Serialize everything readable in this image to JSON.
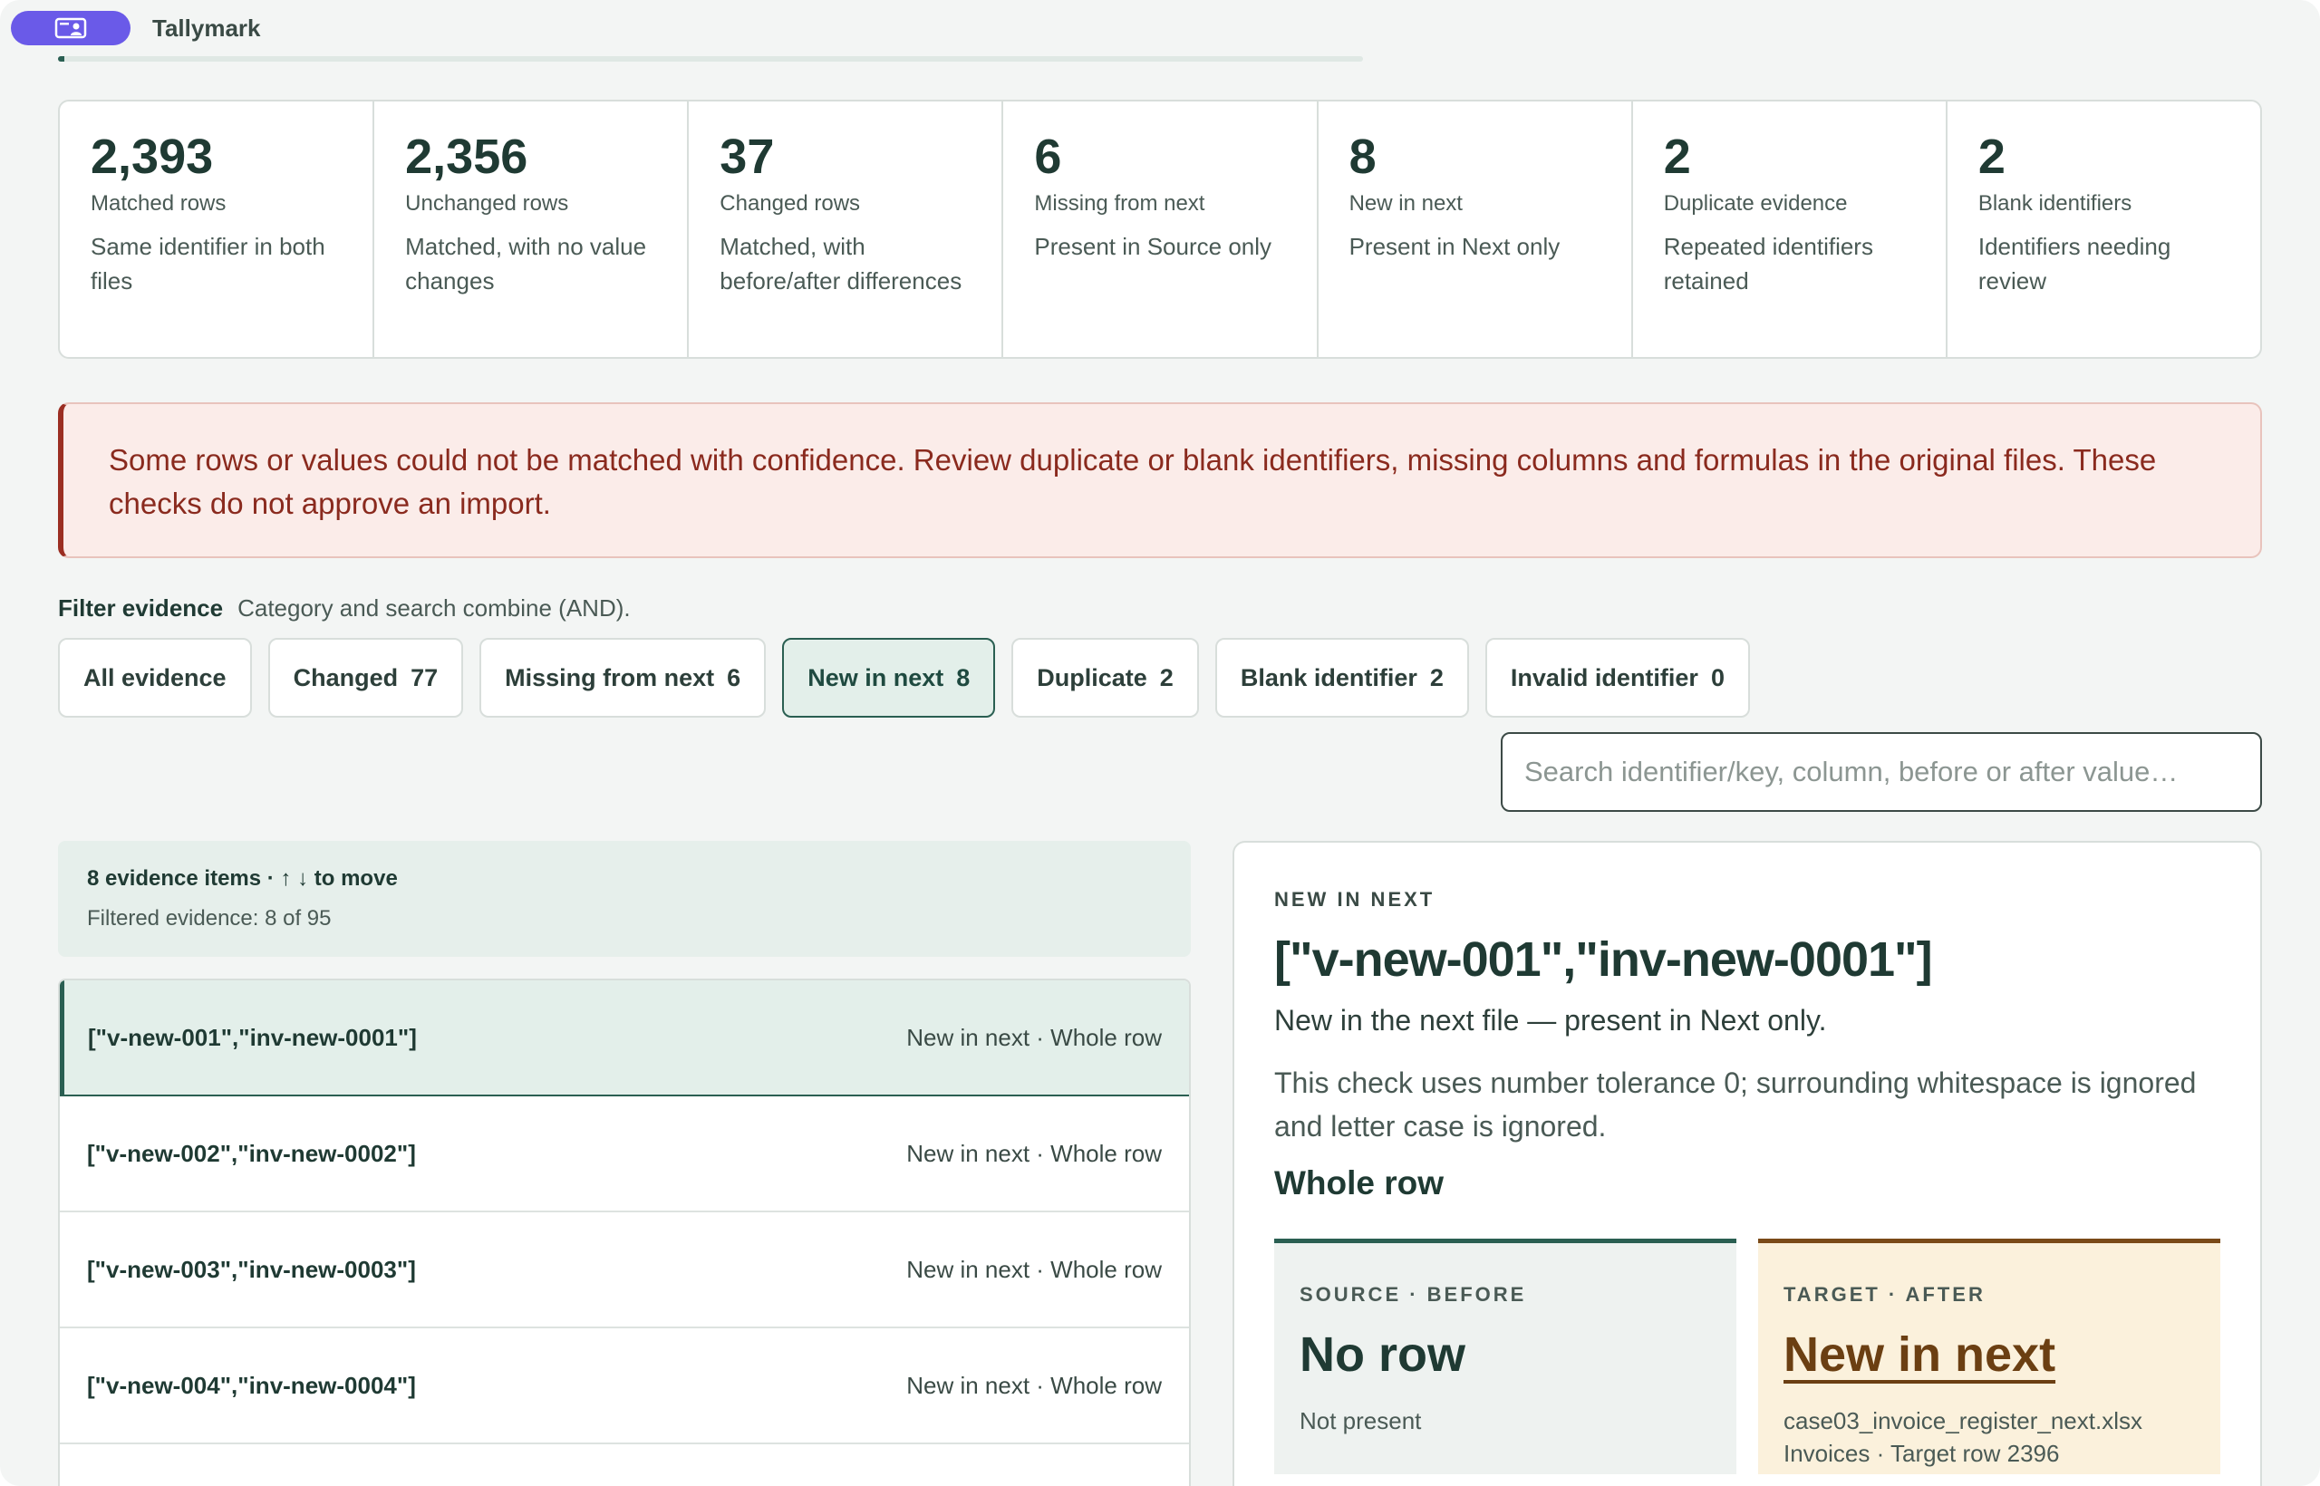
{
  "app": {
    "title": "Tallymark",
    "progress_fraction": 0.005
  },
  "stats": [
    {
      "value": "2,393",
      "label": "Matched rows",
      "desc": "Same identifier in both files"
    },
    {
      "value": "2,356",
      "label": "Unchanged rows",
      "desc": "Matched, with no value changes"
    },
    {
      "value": "37",
      "label": "Changed rows",
      "desc": "Matched, with before/after differences"
    },
    {
      "value": "6",
      "label": "Missing from next",
      "desc": "Present in Source only"
    },
    {
      "value": "8",
      "label": "New in next",
      "desc": "Present in Next only"
    },
    {
      "value": "2",
      "label": "Duplicate evidence",
      "desc": "Repeated identifiers retained"
    },
    {
      "value": "2",
      "label": "Blank identifiers",
      "desc": "Identifiers needing review"
    }
  ],
  "alert": {
    "text": "Some rows or values could not be matched with confidence. Review duplicate or blank identifiers, missing columns and formulas in the original files. These checks do not approve an import."
  },
  "filter": {
    "title": "Filter evidence",
    "subtitle": "Category and search combine (AND).",
    "chips": [
      {
        "label": "All evidence",
        "count": ""
      },
      {
        "label": "Changed",
        "count": "77"
      },
      {
        "label": "Missing from next",
        "count": "6"
      },
      {
        "label": "New in next",
        "count": "8"
      },
      {
        "label": "Duplicate",
        "count": "2"
      },
      {
        "label": "Blank identifier",
        "count": "2"
      },
      {
        "label": "Invalid identifier",
        "count": "0"
      }
    ],
    "active_chip": "New in next",
    "search_placeholder": "Search identifier/key, column, before or after value…"
  },
  "list": {
    "header": "8 evidence items · ↑ ↓ to move",
    "filtered": "Filtered evidence: 8 of 95",
    "rows": [
      {
        "key": "[\"v-new-001\",\"inv-new-0001\"]",
        "meta": "New in next · Whole row"
      },
      {
        "key": "[\"v-new-002\",\"inv-new-0002\"]",
        "meta": "New in next · Whole row"
      },
      {
        "key": "[\"v-new-003\",\"inv-new-0003\"]",
        "meta": "New in next · Whole row"
      },
      {
        "key": "[\"v-new-004\",\"inv-new-0004\"]",
        "meta": "New in next · Whole row"
      },
      {
        "key": "",
        "meta": ""
      }
    ]
  },
  "detail": {
    "category": "NEW IN NEXT",
    "title": "[\"v-new-001\",\"inv-new-0001\"]",
    "summary": "New in the next file — present in Next only.",
    "note": "This check uses number tolerance 0; surrounding whitespace is ignored and letter case is ignored.",
    "section": "Whole row",
    "source": {
      "label": "SOURCE · BEFORE",
      "value": "No row",
      "sub": "Not present"
    },
    "target": {
      "label": "TARGET · AFTER",
      "value": "New in next",
      "file": "case03_invoice_register_next.xlsx",
      "location": "Invoices · Target row 2396"
    }
  },
  "colors": {
    "accent": "#2a5f52",
    "app_pill": "#6a5ae8",
    "alert_text": "#8a2a1e",
    "target_accent": "#7a4a18"
  }
}
